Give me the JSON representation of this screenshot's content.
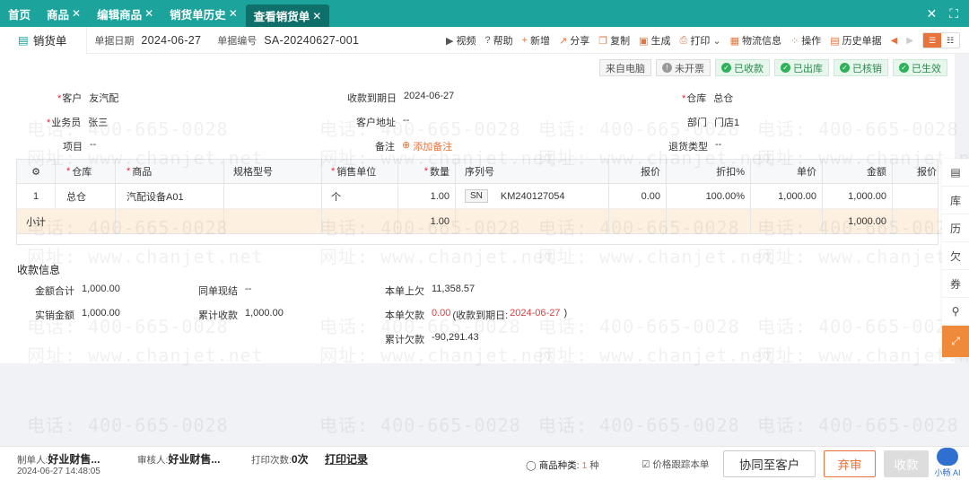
{
  "top_tabs": [
    {
      "label": "首页",
      "closable": false
    },
    {
      "label": "商品",
      "closable": true
    },
    {
      "label": "编辑商品",
      "closable": true
    },
    {
      "label": "销货单历史",
      "closable": true
    },
    {
      "label": "查看销货单",
      "closable": true,
      "active": true
    }
  ],
  "doc": {
    "tab_label": "销货单",
    "date_label": "单据日期",
    "date_value": "2024-06-27",
    "no_label": "单据编号",
    "no_value": "SA-20240627-001"
  },
  "actions": {
    "video": "视频",
    "help": "帮助",
    "add": "新增",
    "share": "分享",
    "copy": "复制",
    "generate": "生成",
    "print": "打印",
    "logistics": "物流信息",
    "operate": "操作",
    "history": "历史单据"
  },
  "status": {
    "source": "来自电脑",
    "invoice": "未开票",
    "received": "已收款",
    "shipped": "已出库",
    "verified": "已核销",
    "effective": "已生效"
  },
  "form": {
    "customer_label": "客户",
    "customer_value": "友汽配",
    "due_label": "收款到期日",
    "due_value": "2024-06-27",
    "warehouse_label": "仓库",
    "warehouse_value": "总仓",
    "salesman_label": "业务员",
    "salesman_value": "张三",
    "address_label": "客户地址",
    "address_value": "--",
    "dept_label": "部门",
    "dept_value": "门店1",
    "project_label": "项目",
    "project_value": "--",
    "remark_label": "备注",
    "remark_add": "添加备注",
    "return_label": "退货类型",
    "return_value": "--"
  },
  "grid": {
    "headers": {
      "warehouse": "仓库",
      "product": "商品",
      "spec": "规格型号",
      "unit": "销售单位",
      "qty": "数量",
      "serial": "序列号",
      "price": "报价",
      "discount": "折扣%",
      "unit_price": "单价",
      "amount": "金额",
      "price2": "报价"
    },
    "row": {
      "no": "1",
      "warehouse": "总仓",
      "product": "汽配设备A01",
      "spec": "",
      "unit": "个",
      "qty": "1.00",
      "sn_tag": "SN",
      "serial": "KM240127054",
      "price": "0.00",
      "discount": "100.00%",
      "unit_price": "1,000.00",
      "amount": "1,000.00"
    },
    "subtotal": {
      "label": "小计",
      "qty": "1.00",
      "amount": "1,000.00"
    }
  },
  "payment": {
    "title": "收款信息",
    "total_label": "金额合计",
    "total_value": "1,000.00",
    "cash_label": "同单现结",
    "cash_value": "--",
    "prev_debt_label": "本单上欠",
    "prev_debt_value": "11,358.57",
    "actual_label": "实销金额",
    "actual_value": "1,000.00",
    "accum_label": "累计收款",
    "accum_value": "1,000.00",
    "cur_debt_label": "本单欠款",
    "cur_debt_value": "0.00",
    "cur_debt_prefix": "(收款到期日:",
    "cur_debt_date": "2024-06-27",
    "cur_debt_suffix": ")",
    "total_debt_label": "累计欠款",
    "total_debt_value": "-90,291.43"
  },
  "rail": [
    "报表",
    "库",
    "历",
    "欠",
    "券",
    "附件",
    "展开"
  ],
  "footer": {
    "maker_label": "制单人:",
    "maker_value": "好业财售...",
    "made_time": "2024-06-27 14:48:05",
    "auditor_label": "审核人:",
    "auditor_value": "好业财售...",
    "print_label": "打印次数:",
    "print_value": "0次",
    "print_log": "打印记录",
    "kinds_label": "商品种类:",
    "kinds_value": "1",
    "kinds_unit": "种",
    "track_label": "价格跟踪本单",
    "sync_btn": "协同至客户",
    "abandon_btn": "弃审",
    "receive_btn": "收款",
    "bot_label": "小畅 AI"
  },
  "watermark": {
    "phone": "电话: 400-665-0028",
    "site": "网址: www.chanjet.net"
  },
  "colors": {
    "brand": "#1ba39c",
    "accent": "#e8743b",
    "ok": "#2fb05a",
    "danger": "#e23c3c"
  }
}
